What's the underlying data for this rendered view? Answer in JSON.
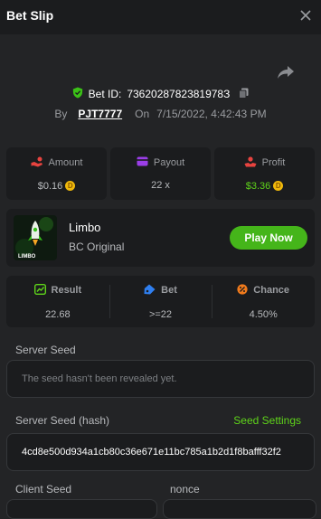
{
  "header": {
    "title": "Bet Slip"
  },
  "bet": {
    "id_label": "Bet ID:",
    "id": "7362028782381978З",
    "by_label": "By",
    "user": "PJT7777",
    "on_label": "On",
    "datetime": "7/15/2022, 4:42:43 PM"
  },
  "stats": {
    "amount_label": "Amount",
    "amount_value": "$0.16",
    "payout_label": "Payout",
    "payout_value": "22 x",
    "profit_label": "Profit",
    "profit_value": "$3.36"
  },
  "game": {
    "name": "Limbo",
    "subtitle": "BC Original",
    "thumb_text": "LIMBO",
    "play_label": "Play Now"
  },
  "results": {
    "result_label": "Result",
    "result_value": "22.68",
    "bet_label": "Bet",
    "bet_value": ">=22",
    "chance_label": "Chance",
    "chance_value": "4.50%"
  },
  "seeds": {
    "server_seed_label": "Server Seed",
    "server_seed_placeholder": "The seed hasn't been revealed yet.",
    "server_hash_label": "Server Seed (hash)",
    "seed_settings_label": "Seed Settings",
    "server_hash_value": "4cd8e500d934a1cb80c36e671e11bc785a1b2d1f8bafff32f2",
    "client_seed_label": "Client Seed",
    "nonce_label": "nonce"
  },
  "colors": {
    "accent_green": "#5fd41a",
    "play_button": "#45b51a",
    "coin": "#f0b90b",
    "panel": "#1b1c1e",
    "background": "#232426"
  }
}
